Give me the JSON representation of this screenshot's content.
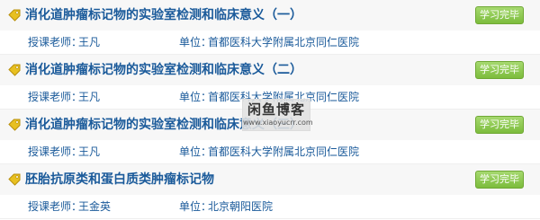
{
  "colors": {
    "title_text": "#1a5a9a",
    "info_text": "#1a5a9a",
    "badge_bg": "#8cc84b",
    "badge_text": "#ffffff",
    "title_row_bg": "#f7f7f7",
    "tag_icon": "#e8c020"
  },
  "icons": {
    "tag": "price-tag-icon"
  },
  "courses": [
    {
      "title": "消化道肿瘤标记物的实验室检测和临床意义（一）",
      "teacher_label": "授课老师：",
      "teacher_name": "王凡",
      "unit_label": "单位：",
      "unit_name": "首都医科大学附属北京同仁医院",
      "status": "学习完毕"
    },
    {
      "title": "消化道肿瘤标记物的实验室检测和临床意义（二）",
      "teacher_label": "授课老师：",
      "teacher_name": "王凡",
      "unit_label": "单位：",
      "unit_name": "首都医科大学附属北京同仁医院",
      "status": "学习完毕"
    },
    {
      "title": "消化道肿瘤标记物的实验室检测和临床意义（三）",
      "teacher_label": "授课老师：",
      "teacher_name": "王凡",
      "unit_label": "单位：",
      "unit_name": "首都医科大学附属北京同仁医院",
      "status": "学习完毕"
    },
    {
      "title": "胚胎抗原类和蛋白质类肿瘤标记物",
      "teacher_label": "授课老师：",
      "teacher_name": "王金英",
      "unit_label": "单位：",
      "unit_name": "北京朝阳医院",
      "status": "学习完毕"
    }
  ],
  "watermark": {
    "main": "闲鱼博客",
    "sub": "www.xiaoyucrr.com"
  }
}
